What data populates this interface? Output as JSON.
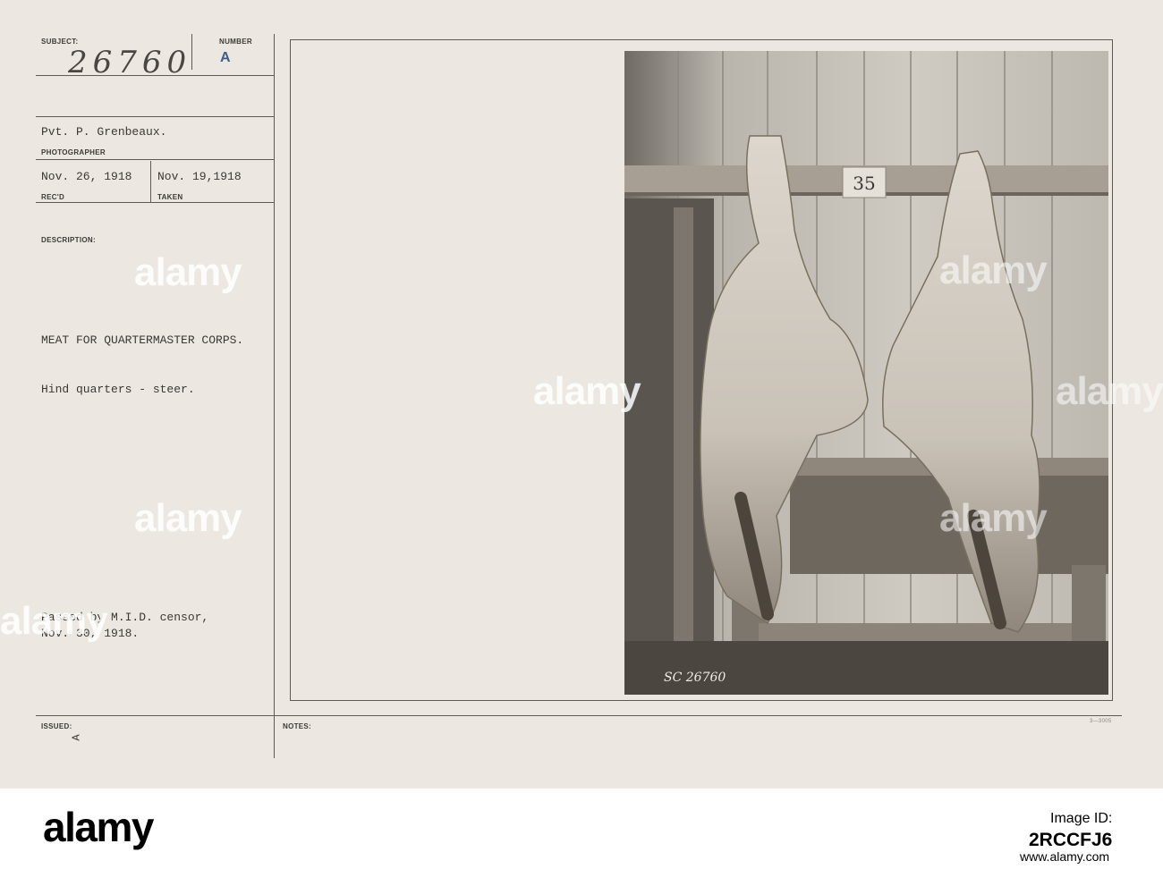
{
  "card": {
    "subject_label": "SUBJECT:",
    "subject_value": "26760",
    "number_label": "NUMBER",
    "number_value": "A",
    "photographer_value": "Pvt. P. Grenbeaux.",
    "photographer_label": "PHOTOGRAPHER",
    "recd_value": "Nov. 26, 1918",
    "recd_label": "REC'D",
    "taken_value": "Nov. 19,1918",
    "taken_label": "TAKEN",
    "description_label": "DESCRIPTION:",
    "description_title": "MEAT FOR QUARTERMASTER CORPS.",
    "description_line": "Hind quarters - steer.",
    "censor_line1": "Passed by M.I.D. censor,",
    "censor_line2": "Nov. 30, 1918.",
    "issued_label": "ISSUED:",
    "issued_mark": "A",
    "notes_label": "NOTES:",
    "form_code": "3—3005"
  },
  "photo": {
    "tag_number": "35",
    "negative_inscription": "SC 26760"
  },
  "watermarks": [
    "alamy",
    "alamy",
    "alamy",
    "alamy",
    "alamy",
    "alamy",
    "alamy"
  ],
  "footer": {
    "logo": "alamy",
    "image_id_label": "Image ID:",
    "image_id": "2RCCFJ6",
    "url": "www.alamy.com"
  },
  "colors": {
    "card_background": "#ece7e1",
    "ink": "#3b3835",
    "stamp_blue": "#3d5f86"
  }
}
